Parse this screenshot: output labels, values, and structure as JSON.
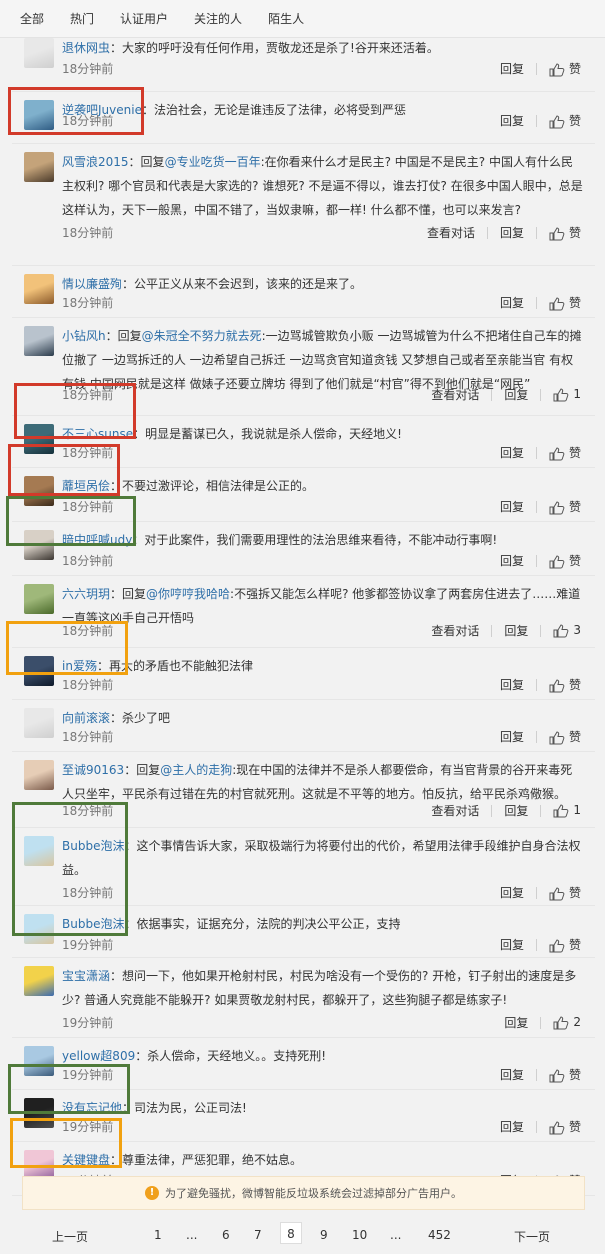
{
  "tabs": [
    "全部",
    "热门",
    "认证用户",
    "关注的人",
    "陌生人"
  ],
  "labels": {
    "reply": "回复",
    "like": "赞",
    "view_conv": "查看对话",
    "sep": "|"
  },
  "comments": [
    {
      "name": "退休网虫",
      "text": "：大家的呼吁没有任何作用，贾敬龙还是杀了!谷开来还活着。",
      "time": "18分钟前",
      "like": "赞",
      "conv": ""
    },
    {
      "name": "逆袭吧Juvenie",
      "text": "：法治社会，无论是谁违反了法律，必将受到严惩",
      "time": "18分钟前",
      "like": "赞",
      "conv": ""
    },
    {
      "name": "风雪浪2015",
      "prefix": "：回复",
      "ref": "@专业吃货一百年",
      "text": ":在你看来什么才是民主? 中国是不是民主? 中国人有什么民主权利? 哪个官员和代表是大家选的? 谁想死? 不是逼不得以，谁去打仗? 在很多中国人眼中，总是这样认为，天下一般黑，中国不错了，当奴隶嘛，都一样! 什么都不懂，也可以来发言?",
      "time": "18分钟前",
      "like": "赞",
      "conv": "查看对话"
    },
    {
      "name": "情以廉盛殉",
      "text": "：公平正义从来不会迟到，该来的还是来了。",
      "time": "18分钟前",
      "like": "赞",
      "conv": ""
    },
    {
      "name": "小钻风h",
      "prefix": "：回复",
      "ref": "@朱冠全不努力就去死",
      "text": ":一边骂城管欺负小贩 一边骂城管为什么不把堵住自己车的摊位撤了 一边骂拆迁的人 一边希望自己拆迁 一边骂贪官知道贪钱 又梦想自己或者至亲能当官 有权有钱 中国网民就是这样 做婊子还要立牌坊 得到了他们就是“村官”得不到他们就是“网民”",
      "time": "18分钟前",
      "like": "1",
      "conv": "查看对话"
    },
    {
      "name": "不三心sunse",
      "text": "：明显是蓄谋已久，我说就是杀人偿命，天经地义!",
      "time": "18分钟前",
      "like": "赞",
      "conv": ""
    },
    {
      "name": "蘼垣呙侩",
      "text": "：不要过激评论，相信法律是公正的。",
      "time": "18分钟前",
      "like": "赞",
      "conv": ""
    },
    {
      "name": "暗中呼喊udy",
      "text": "：对于此案件，我们需要用理性的法治思维来看待，不能冲动行事啊!",
      "time": "18分钟前",
      "like": "赞",
      "conv": ""
    },
    {
      "name": "六六玥玥",
      "prefix": "：回复",
      "ref": "@你哼哼我哈哈",
      "text": ":不强拆又能怎么样呢? 他爹都签协议拿了两套房住进去了……难道一直等这凶手自己开悟吗",
      "time": "18分钟前",
      "like": "3",
      "conv": "查看对话"
    },
    {
      "name": "in爱殇",
      "text": "：再大的矛盾也不能触犯法律",
      "time": "18分钟前",
      "like": "赞",
      "conv": ""
    },
    {
      "name": "向前滚滚",
      "text": "：杀少了吧",
      "time": "18分钟前",
      "like": "赞",
      "conv": ""
    },
    {
      "name": "至诚90163",
      "prefix": "：回复",
      "ref": "@主人的走狗",
      "text": ":现在中国的法律并不是杀人都要偿命，有当官背景的谷开来毒死人只坐牢，平民杀有过错在先的村官就死刑。这就是不平等的地方。怕反抗，给平民杀鸡儆猴。",
      "time": "18分钟前",
      "like": "1",
      "conv": "查看对话"
    },
    {
      "name": "Bubbe泡沫",
      "text": "：这个事情告诉大家，采取极端行为将要付出的代价，希望用法律手段维护自身合法权益。",
      "time": "18分钟前",
      "like": "赞",
      "conv": ""
    },
    {
      "name": "Bubbe泡沫",
      "text": "：依据事实，证据充分，法院的判决公平公正，支持",
      "time": "19分钟前",
      "like": "赞",
      "conv": ""
    },
    {
      "name": "宝宝潇涵",
      "text": "：想问一下，他如果开枪射村民，村民为啥没有一个受伤的? 开枪，钉子射出的速度是多少? 普通人究竟能不能躲开? 如果贾敬龙射村民，都躲开了，这些狗腿子都是练家子!",
      "time": "19分钟前",
      "like": "2",
      "conv": ""
    },
    {
      "name": "yellow超809",
      "text": "：杀人偿命，天经地义。。支持死刑!",
      "time": "19分钟前",
      "like": "赞",
      "conv": ""
    },
    {
      "name": "没有忘记他",
      "text": "：司法为民，公正司法!",
      "time": "19分钟前",
      "like": "赞",
      "conv": ""
    },
    {
      "name": "关键键盘",
      "text": "：尊重法律，严惩犯罪，绝不姑息。",
      "time": "19分钟前",
      "like": "赞",
      "conv": ""
    }
  ],
  "notice": "为了避免骚扰，微博智能反垃圾系统会过滤掉部分广告用户。",
  "notice_icon": "!",
  "pager": {
    "prev": "上一页",
    "next": "下一页",
    "pages": [
      "1",
      "...",
      "6",
      "7",
      "8",
      "9",
      "10",
      "...",
      "452"
    ],
    "current": "8"
  },
  "colors": {
    "link": "#2e6fa8",
    "red_box": "#d23a2a",
    "green_box": "#4f7a3a",
    "orange_box": "#f1a10f"
  }
}
